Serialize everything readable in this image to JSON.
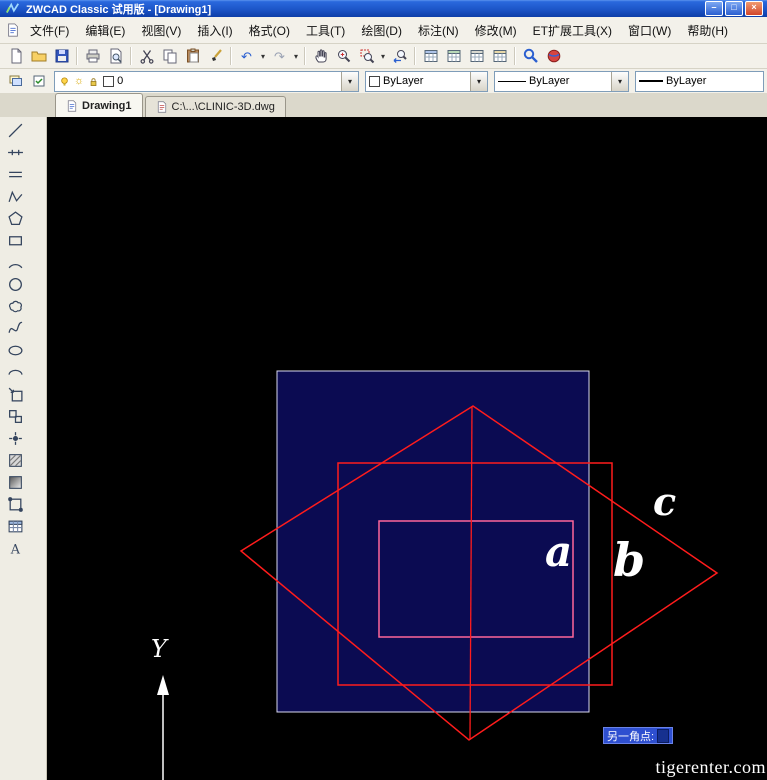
{
  "window": {
    "title": "ZWCAD Classic 试用版 - [Drawing1]",
    "controls": {
      "minimize": "–",
      "maximize": "□",
      "close": "×"
    }
  },
  "ui": {
    "caret": "▾"
  },
  "menubar": {
    "items": [
      "文件(F)",
      "编辑(E)",
      "视图(V)",
      "插入(I)",
      "格式(O)",
      "工具(T)",
      "绘图(D)",
      "标注(N)",
      "修改(M)",
      "ET扩展工具(X)",
      "窗口(W)",
      "帮助(H)"
    ]
  },
  "toolbar_main": {
    "glyphs": {
      "undo": "↶",
      "redo": "↷"
    },
    "icons": [
      "new",
      "open",
      "save",
      "plot",
      "print-preview",
      "cut",
      "copy",
      "paste",
      "match-properties",
      "undo",
      "redo",
      "pan",
      "zoom-realtime",
      "zoom-window",
      "zoom-previous",
      "table-style-1",
      "table-style-2",
      "table-style-3",
      "table-style-4",
      "find",
      "about"
    ]
  },
  "toolbar_properties": {
    "layer": {
      "value": "0",
      "glyphs": {
        "freeze": "☼"
      }
    },
    "color": {
      "value": "ByLayer"
    },
    "linetype": {
      "value": "ByLayer"
    },
    "lineweight": {
      "value": "ByLayer"
    }
  },
  "tabs": [
    {
      "label": "Drawing1"
    },
    {
      "label": "C:\\...\\CLINIC-3D.dwg"
    }
  ],
  "canvas": {
    "prompt": {
      "label": "另一角点:"
    },
    "ucs_axis_label": "Y",
    "annotations": {
      "a": "a",
      "b": "b",
      "c": "c"
    },
    "watermark": "tigerenter.com",
    "colors": {
      "background": "#000000",
      "navy_fill": "#0b0b52",
      "square_border": "#d8d8f0",
      "red": "#ff1c1c",
      "pink": "#ff6699",
      "prompt_bg": "#2e4fd0"
    }
  }
}
